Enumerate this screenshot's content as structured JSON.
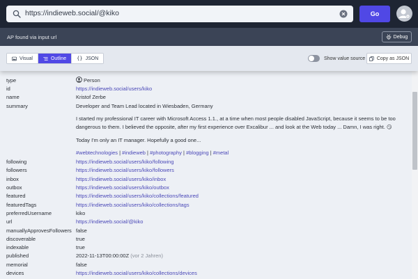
{
  "header": {
    "url_value": "https://indieweb.social/@kiko",
    "go_label": "Go"
  },
  "status": {
    "message": "AP found via input url",
    "debug_label": "Debug"
  },
  "toolbar": {
    "tabs": [
      {
        "label": "Visual",
        "icon": "visual-icon"
      },
      {
        "label": "Outline",
        "icon": "outline-icon"
      },
      {
        "label": "JSON",
        "icon": "code-icon"
      }
    ],
    "active_tab": "Outline",
    "show_value_source_label": "Show value source",
    "copy_json_label": "Copy as JSON"
  },
  "object": {
    "type": {
      "key": "type",
      "value": "Person",
      "icon": "person-icon"
    },
    "id": {
      "key": "id",
      "value": "https://indieweb.social/users/kiko"
    },
    "name": {
      "key": "name",
      "value": "Kristof Zerbe"
    },
    "summary": {
      "key": "summary",
      "line1": "Developer and Team Lead located in Wiesbaden, Germany",
      "p2a": "I started my professional IT career with Microsoft Access 1.1., at a time when most people disabled JavaScript, because it seems to be too",
      "p2b": "dangerous to them. I believed the opposite, after my first experience over Excalibur ... and look at the Web today ... Damn, I was right. 😏",
      "p3": "Today I'm only an IT manager. Hopefully a good one...",
      "tags": [
        "#webtechnologies",
        "#indieweb",
        "#photography",
        "#blogging",
        "#metal"
      ],
      "tag_separator": " | "
    },
    "following": {
      "key": "following",
      "value": "https://indieweb.social/users/kiko/following"
    },
    "followers": {
      "key": "followers",
      "value": "https://indieweb.social/users/kiko/followers"
    },
    "inbox": {
      "key": "inbox",
      "value": "https://indieweb.social/users/kiko/inbox"
    },
    "outbox": {
      "key": "outbox",
      "value": "https://indieweb.social/users/kiko/outbox"
    },
    "featured": {
      "key": "featured",
      "value": "https://indieweb.social/users/kiko/collections/featured"
    },
    "featuredTags": {
      "key": "featuredTags",
      "value": "https://indieweb.social/users/kiko/collections/tags"
    },
    "preferredUsername": {
      "key": "preferredUsername",
      "value": "kiko"
    },
    "url": {
      "key": "url",
      "value": "https://indieweb.social/@kiko"
    },
    "manuallyApprovesFollowers": {
      "key": "manuallyApprovesFollowers",
      "value": "false"
    },
    "discoverable": {
      "key": "discoverable",
      "value": "true"
    },
    "indexable": {
      "key": "indexable",
      "value": "true"
    },
    "published": {
      "key": "published",
      "value": "2022-11-13T00:00:00Z",
      "relative": "(vor 2 Jahren)"
    },
    "memorial": {
      "key": "memorial",
      "value": "false"
    },
    "devices": {
      "key": "devices",
      "value": "https://indieweb.social/users/kiko/collections/devices"
    }
  },
  "colors": {
    "accent": "#5048e5",
    "header_bg": "#1e2533",
    "status_bg": "#3b4456",
    "link": "#4b49b8"
  }
}
